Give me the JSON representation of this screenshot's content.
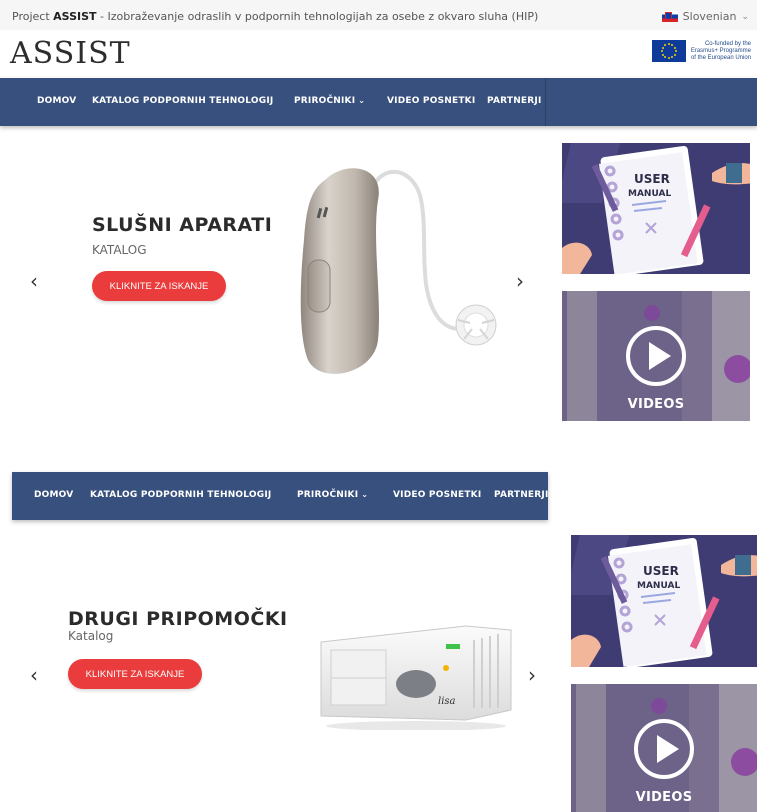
{
  "topbar": {
    "project_label": "Project",
    "project_name": "ASSIST",
    "project_desc": "- Izobraževanje odraslih v podpornih tehnologijah za osebe z okvaro sluha (HIP)",
    "language": "Slovenian"
  },
  "logo": {
    "text": "ASSIST"
  },
  "eu": {
    "line1": "Co-funded by the",
    "line2": "Erasmus+ Programme",
    "line3": "of the European Union"
  },
  "nav": {
    "items": [
      {
        "label": "DOMOV"
      },
      {
        "label": "KATALOG PODPORNIH TEHNOLOGIJ"
      },
      {
        "label": "PRIROČNIKI"
      },
      {
        "label": "VIDEO POSNETKI"
      },
      {
        "label": "PARTNERJI"
      }
    ]
  },
  "slide1": {
    "title": "SLUŠNI APARATI",
    "subtitle": "KATALOG",
    "button": "KLIKNITE ZA ISKANJE",
    "prev": "‹",
    "next": "›"
  },
  "slide2": {
    "title": "DRUGI PRIPOMOČKI",
    "subtitle": "Katalog",
    "button": "KLIKNITE ZA ISKANJE",
    "prev": "‹",
    "next": "›"
  },
  "tiles": {
    "manual_line1": "USER",
    "manual_line2": "MANUAL",
    "video_label": "VIDEOS"
  },
  "device": {
    "brand": "lisa"
  },
  "icons": {
    "language_flag": "slovenia-flag-icon",
    "eu_flag": "eu-flag-icon",
    "dropdown": "chevron-down-icon",
    "prev": "chevron-left-icon",
    "next": "chevron-right-icon",
    "play": "play-icon"
  },
  "colors": {
    "nav": "#38507d",
    "cta": "#ea3c3c",
    "manual_tile": "#3f3c74"
  }
}
